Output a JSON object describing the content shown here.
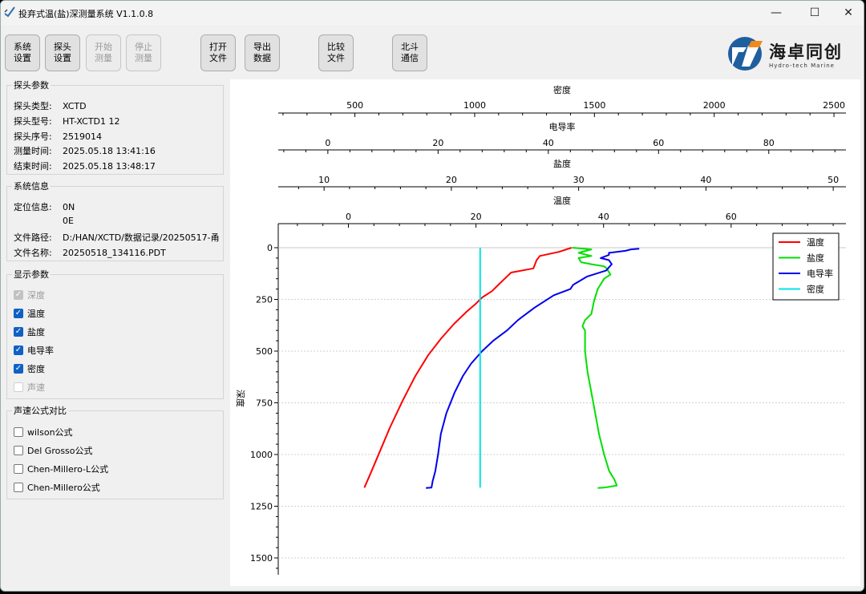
{
  "window": {
    "title": "投弃式温(盐)深测量系统 V1.1.0.8",
    "minimize": "—",
    "maximize": "☐",
    "close": "✕"
  },
  "toolbar": [
    {
      "id": "sys-settings",
      "l1": "系统",
      "l2": "设置",
      "enabled": true
    },
    {
      "id": "probe-settings",
      "l1": "探头",
      "l2": "设置",
      "enabled": true
    },
    {
      "id": "start-measure",
      "l1": "开始",
      "l2": "测量",
      "enabled": false
    },
    {
      "id": "stop-measure",
      "l1": "停止",
      "l2": "测量",
      "enabled": false
    },
    {
      "id": "open-file",
      "l1": "打开",
      "l2": "文件",
      "enabled": true
    },
    {
      "id": "export-data",
      "l1": "导出",
      "l2": "数据",
      "enabled": true
    },
    {
      "id": "compare-file",
      "l1": "比较",
      "l2": "文件",
      "enabled": true
    },
    {
      "id": "beidou-comm",
      "l1": "北斗",
      "l2": "通信",
      "enabled": true
    }
  ],
  "logo": {
    "name": "海卓同创",
    "sub": "Hydro-tech Marine",
    "color": "#2a6fb0"
  },
  "probe_params": {
    "title": "探头参数",
    "rows": [
      {
        "k": "探头类型:",
        "v": "XCTD"
      },
      {
        "k": "探头型号:",
        "v": "HT-XCTD1 12"
      },
      {
        "k": "探头序号:",
        "v": "2519014"
      },
      {
        "k": "测量时间:",
        "v": "2025.05.18 13:41:16"
      },
      {
        "k": "结束时间:",
        "v": "2025.05.18 13:48:17"
      }
    ]
  },
  "system_info": {
    "title": "系统信息",
    "rows": [
      {
        "k": "定位信息:",
        "v": "0N"
      },
      {
        "k": "",
        "v": "0E"
      },
      {
        "k": "文件路径:",
        "v": "D:/HAN/XCTD/数据记录/20250517-甬"
      },
      {
        "k": "文件名称:",
        "v": "20250518_134116.PDT"
      }
    ]
  },
  "display_params": {
    "title": "显示参数",
    "items": [
      {
        "label": "深度",
        "checked": true,
        "disabled": true
      },
      {
        "label": "温度",
        "checked": true,
        "disabled": false
      },
      {
        "label": "盐度",
        "checked": true,
        "disabled": false
      },
      {
        "label": "电导率",
        "checked": true,
        "disabled": false
      },
      {
        "label": "密度",
        "checked": true,
        "disabled": false
      },
      {
        "label": "声速",
        "checked": false,
        "disabled": true
      }
    ]
  },
  "sound_speed": {
    "title": "声速公式对比",
    "items": [
      {
        "label": "wilson公式",
        "checked": false
      },
      {
        "label": "Del Grosso公式",
        "checked": false
      },
      {
        "label": "Chen-Millero-L公式",
        "checked": false
      },
      {
        "label": "Chen-Millero公式",
        "checked": false
      }
    ]
  },
  "chart_data": {
    "type": "line",
    "ylabel": "深度",
    "y_inverted": true,
    "ylim": [
      -50,
      1580
    ],
    "yticks": [
      0,
      250,
      500,
      750,
      1000,
      1250,
      1500
    ],
    "axes": [
      {
        "label": "密度",
        "xlim": [
          180,
          2550
        ],
        "ticks": [
          500,
          1000,
          1500,
          2000,
          2500
        ]
      },
      {
        "label": "电导率",
        "xlim": [
          -9,
          94
        ],
        "ticks": [
          0,
          20,
          40,
          60,
          80
        ]
      },
      {
        "label": "盐度",
        "xlim": [
          6.4,
          51
        ],
        "ticks": [
          10,
          20,
          30,
          40,
          50
        ]
      },
      {
        "label": "温度",
        "xlim": [
          -11,
          78
        ],
        "ticks": [
          0,
          20,
          40,
          60
        ]
      }
    ],
    "legend_position": "top-right",
    "series": [
      {
        "name": "温度",
        "axis": 3,
        "color": "#ff0000",
        "points": [
          [
            35,
            0
          ],
          [
            33,
            20
          ],
          [
            30,
            40
          ],
          [
            29.5,
            60
          ],
          [
            29,
            100
          ],
          [
            25.5,
            120
          ],
          [
            24.5,
            150
          ],
          [
            23.5,
            180
          ],
          [
            22.5,
            210
          ],
          [
            21,
            240
          ],
          [
            20,
            270
          ],
          [
            18.5,
            310
          ],
          [
            16.5,
            370
          ],
          [
            14.5,
            440
          ],
          [
            12.5,
            520
          ],
          [
            10.5,
            620
          ],
          [
            8.5,
            740
          ],
          [
            6.5,
            870
          ],
          [
            5,
            980
          ],
          [
            3.5,
            1090
          ],
          [
            2.5,
            1160
          ]
        ]
      },
      {
        "name": "盐度",
        "axis": 2,
        "color": "#00e000",
        "points": [
          [
            29.5,
            0
          ],
          [
            31,
            8
          ],
          [
            30,
            25
          ],
          [
            31,
            40
          ],
          [
            30,
            50
          ],
          [
            30.2,
            70
          ],
          [
            31,
            80
          ],
          [
            32,
            90
          ],
          [
            32.2,
            100
          ],
          [
            32.5,
            130
          ],
          [
            32,
            150
          ],
          [
            31.5,
            200
          ],
          [
            31.2,
            260
          ],
          [
            31,
            320
          ],
          [
            30.5,
            350
          ],
          [
            30.3,
            380
          ],
          [
            30.5,
            400
          ],
          [
            30.5,
            500
          ],
          [
            30.7,
            600
          ],
          [
            31,
            700
          ],
          [
            31.3,
            800
          ],
          [
            31.6,
            900
          ],
          [
            32,
            1000
          ],
          [
            32.4,
            1080
          ],
          [
            32.8,
            1120
          ],
          [
            33,
            1150
          ],
          [
            32,
            1160
          ],
          [
            31.5,
            1162
          ]
        ]
      },
      {
        "name": "电导率",
        "axis": 1,
        "color": "#0000ee",
        "points": [
          [
            56.5,
            5
          ],
          [
            55,
            8
          ],
          [
            54,
            15
          ],
          [
            51,
            25
          ],
          [
            51,
            35
          ],
          [
            49.5,
            50
          ],
          [
            51,
            60
          ],
          [
            51.5,
            80
          ],
          [
            50.5,
            110
          ],
          [
            47,
            140
          ],
          [
            44.5,
            180
          ],
          [
            44,
            200
          ],
          [
            41,
            230
          ],
          [
            37.5,
            290
          ],
          [
            35,
            340
          ],
          [
            34.5,
            350
          ],
          [
            32.5,
            400
          ],
          [
            30,
            450
          ],
          [
            28,
            500
          ],
          [
            26,
            560
          ],
          [
            24.5,
            620
          ],
          [
            23,
            700
          ],
          [
            21.5,
            800
          ],
          [
            20.5,
            900
          ],
          [
            20,
            1000
          ],
          [
            19.5,
            1080
          ],
          [
            19,
            1130
          ],
          [
            18.8,
            1160
          ],
          [
            17.8,
            1162
          ]
        ]
      },
      {
        "name": "密度",
        "axis": 0,
        "color": "#00e6e6",
        "points": [
          [
            1023,
            0
          ],
          [
            1023,
            1160
          ]
        ]
      }
    ]
  }
}
